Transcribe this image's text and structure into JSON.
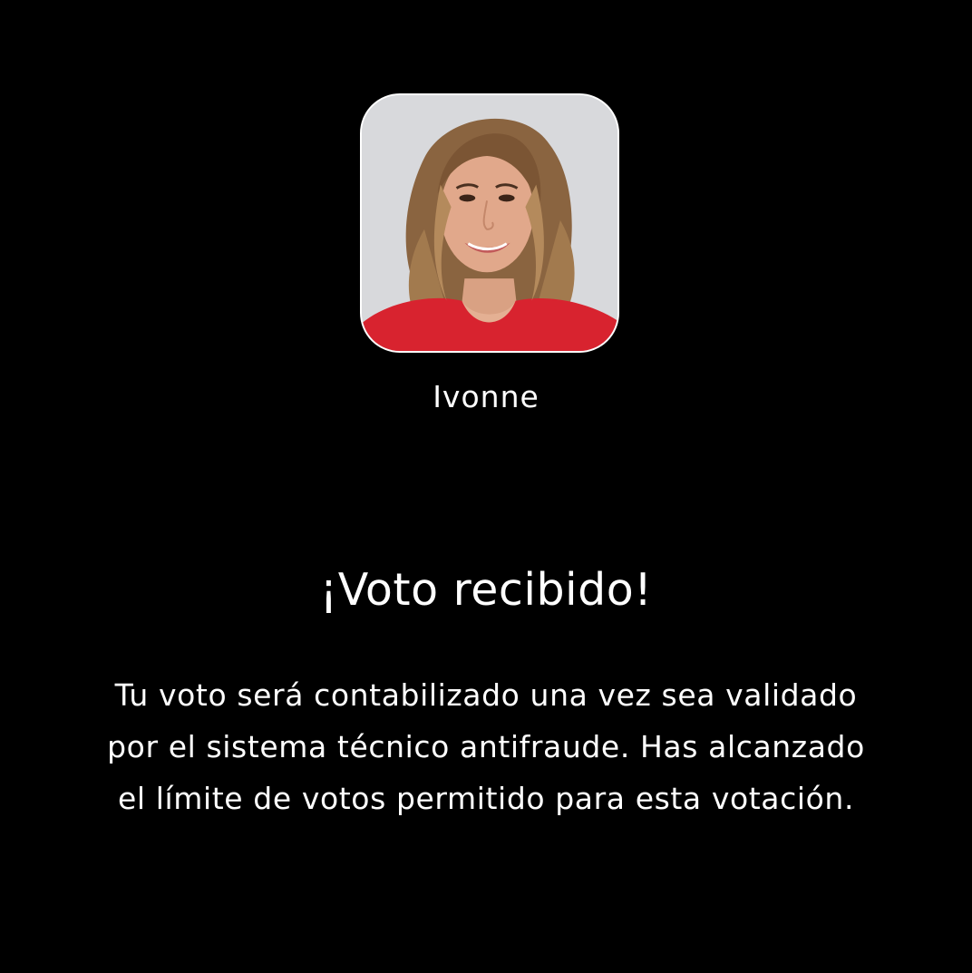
{
  "contestant": {
    "name": "Ivonne",
    "photo_icon": "contestant-portrait"
  },
  "confirmation": {
    "title": "¡Voto recibido!",
    "message": "Tu voto será contabilizado una vez sea validado por el sistema técnico antifraude. Has alcanzado el límite de votos permitido para esta votación."
  },
  "colors": {
    "background": "#000000",
    "text": "#ffffff",
    "shirt": "#d8232f"
  }
}
